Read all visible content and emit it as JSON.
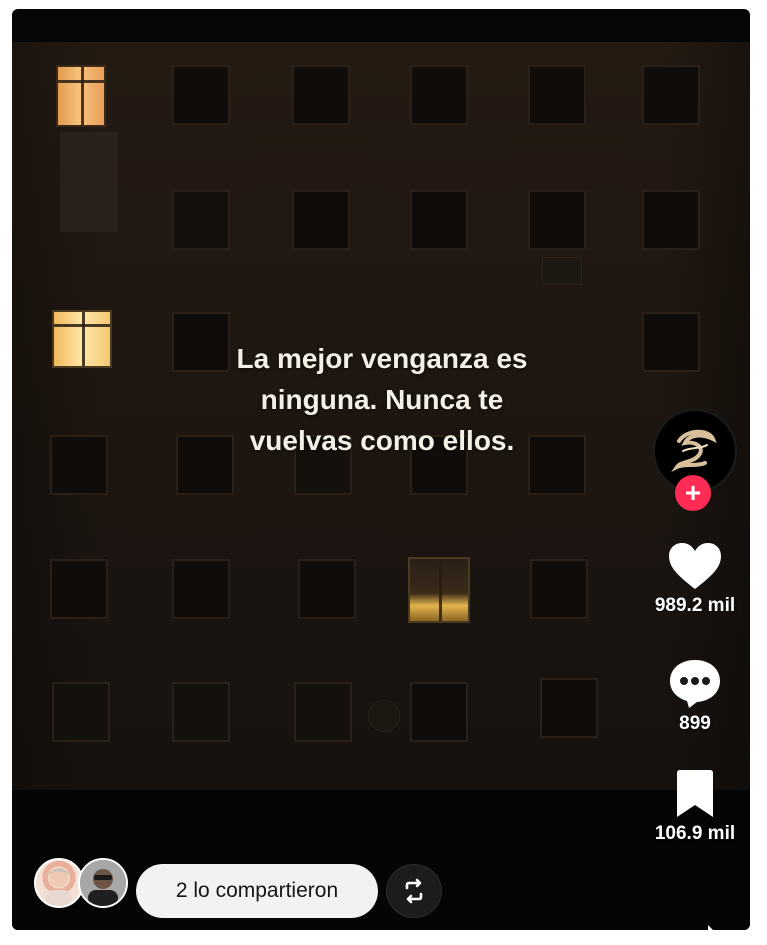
{
  "video": {
    "overlay_lines": [
      "La mejor venganza es",
      "ninguna. Nunca te",
      "vuelvas como ellos."
    ]
  },
  "actions": {
    "follow_symbol": "+",
    "likes": "989.2 mil",
    "comments": "899",
    "saves": "106.9 mil"
  },
  "share": {
    "label": "2 lo compartieron"
  },
  "icons": {
    "creator_avatar": "creator-avatar-icon",
    "heart": "heart-icon",
    "comment": "comment-bubble-icon",
    "bookmark": "bookmark-icon",
    "repost": "repost-icon",
    "share_arrow": "share-arrow-icon"
  },
  "colors": {
    "follow_accent": "#fe2c55",
    "share_pill": "#f2f2f2",
    "frame": "#060606"
  }
}
